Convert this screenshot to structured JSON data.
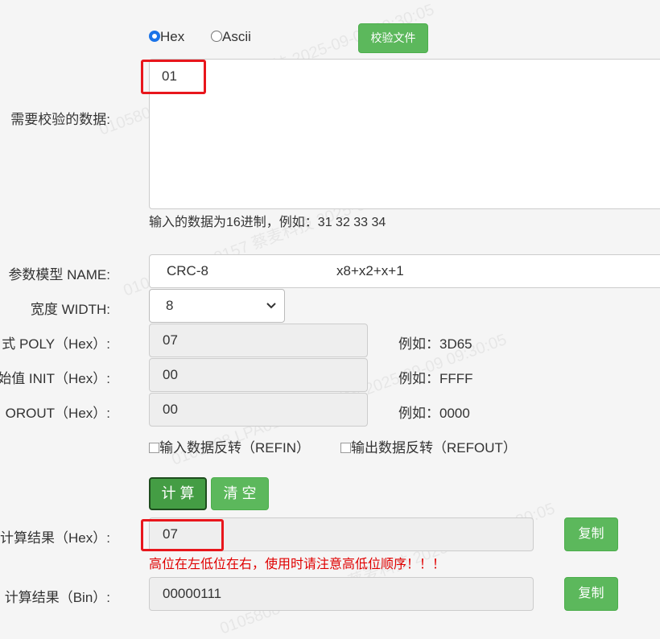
{
  "format": {
    "hex_label": "Hex",
    "ascii_label": "Ascii",
    "selected": "Hex"
  },
  "verify_file_button": "校验文件",
  "data_section": {
    "label": "需要校验的数据:",
    "value": "01",
    "hint": "输入的数据为16进制，例如：31 32 33 34"
  },
  "params": {
    "model_label": "参数模型 NAME:",
    "model_name": "CRC-8",
    "model_poly": "x8+x2+x+1",
    "width_label": "宽度 WIDTH:",
    "width_value": "8",
    "poly_label": "式 POLY（Hex）:",
    "poly_value": "07",
    "poly_example": "例如：3D65",
    "init_label": "始值 INIT（Hex）:",
    "init_value": "00",
    "init_example": "例如：FFFF",
    "xorout_label": "OROUT（Hex）:",
    "xorout_value": "00",
    "xorout_example": "例如：0000",
    "refin_label": "输入数据反转（REFIN）",
    "refout_label": "输出数据反转（REFOUT）"
  },
  "actions": {
    "calc": "计 算",
    "clear": "清 空"
  },
  "results": {
    "hex_label": "计算结果（Hex）:",
    "hex_value": "07",
    "warning": "高位在左低位在右，使用时请注意高低位顺序！！！",
    "bin_label": "计算结果（Bin）:",
    "bin_value": "00000111",
    "copy": "复制"
  },
  "colors": {
    "green": "#5cb85c",
    "dark_green": "#3d8b3d",
    "red": "#e8161c",
    "warning": "#e00000"
  },
  "watermark": {
    "text1": "0105808 LPA0157 蔡麦科技 2025-09-09 09:30:05"
  }
}
